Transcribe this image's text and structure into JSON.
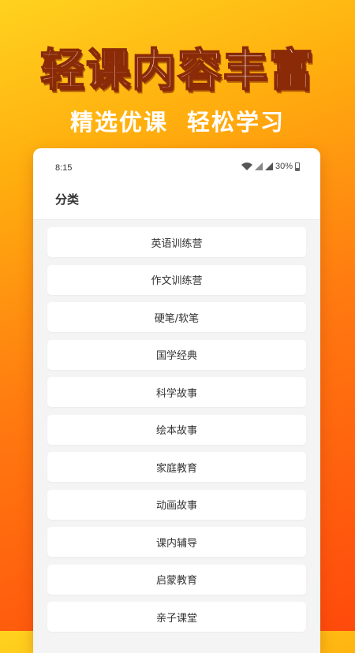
{
  "promo": {
    "headline": "轻课内容丰富",
    "subhead": "精选优课 轻松学习"
  },
  "status_bar": {
    "time": "8:15",
    "battery": "30%",
    "icons": [
      "wifi-icon",
      "signal-icon",
      "signal-icon",
      "battery-icon"
    ]
  },
  "app_bar": {
    "title": "分类"
  },
  "categories": [
    {
      "label": "英语训练营"
    },
    {
      "label": "作文训练营"
    },
    {
      "label": "硬笔/软笔"
    },
    {
      "label": "国学经典"
    },
    {
      "label": "科学故事"
    },
    {
      "label": "绘本故事"
    },
    {
      "label": "家庭教育"
    },
    {
      "label": "动画故事"
    },
    {
      "label": "课内辅导"
    },
    {
      "label": "启蒙教育"
    },
    {
      "label": "亲子课堂"
    }
  ],
  "colors": {
    "background_top": "#ffd21f",
    "background_bottom": "#ff4a0c",
    "headline_outline": "#8a2a06",
    "list_bg": "#f4f4f4",
    "card_bg": "#ffffff",
    "text": "#333333"
  }
}
